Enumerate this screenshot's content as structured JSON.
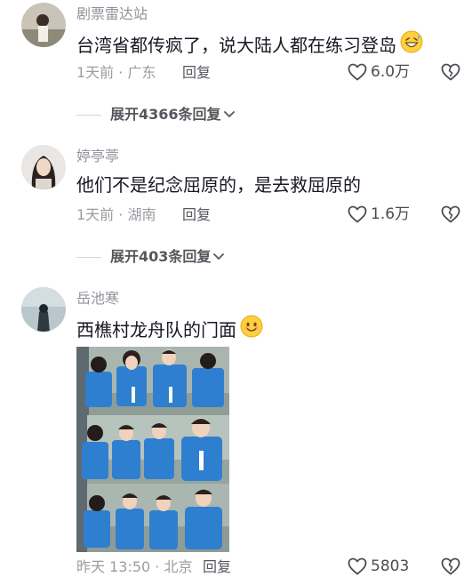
{
  "comments": [
    {
      "username": "剧票雷达站",
      "text": "台湾省都传疯了，说大陆人都在练习登岛",
      "emoji": "sweat-grin-emoji",
      "time_location": "1天前 · 广东",
      "reply_label": "回复",
      "like_count": "6.0万",
      "expand_label": "展开4366条回复"
    },
    {
      "username": "婷亭葶",
      "text": "他们不是纪念屈原的，是去救屈原的",
      "time_location": "1天前 · 湖南",
      "reply_label": "回复",
      "like_count": "1.6万",
      "expand_label": "展开403条回复"
    },
    {
      "username": "岳池寒",
      "text": "西樵村龙舟队的门面",
      "emoji": "smile-emoji",
      "time_location": "昨天 13:50 · 北京",
      "reply_label": "回复",
      "like_count": "5803"
    }
  ],
  "icons": {
    "like": "heart-outline-icon",
    "dislike": "broken-heart-icon",
    "expand": "chevron-down-icon"
  },
  "colors": {
    "text_primary": "#161823",
    "text_secondary": "#8f9399",
    "life_jacket": "#2f7fd0"
  }
}
